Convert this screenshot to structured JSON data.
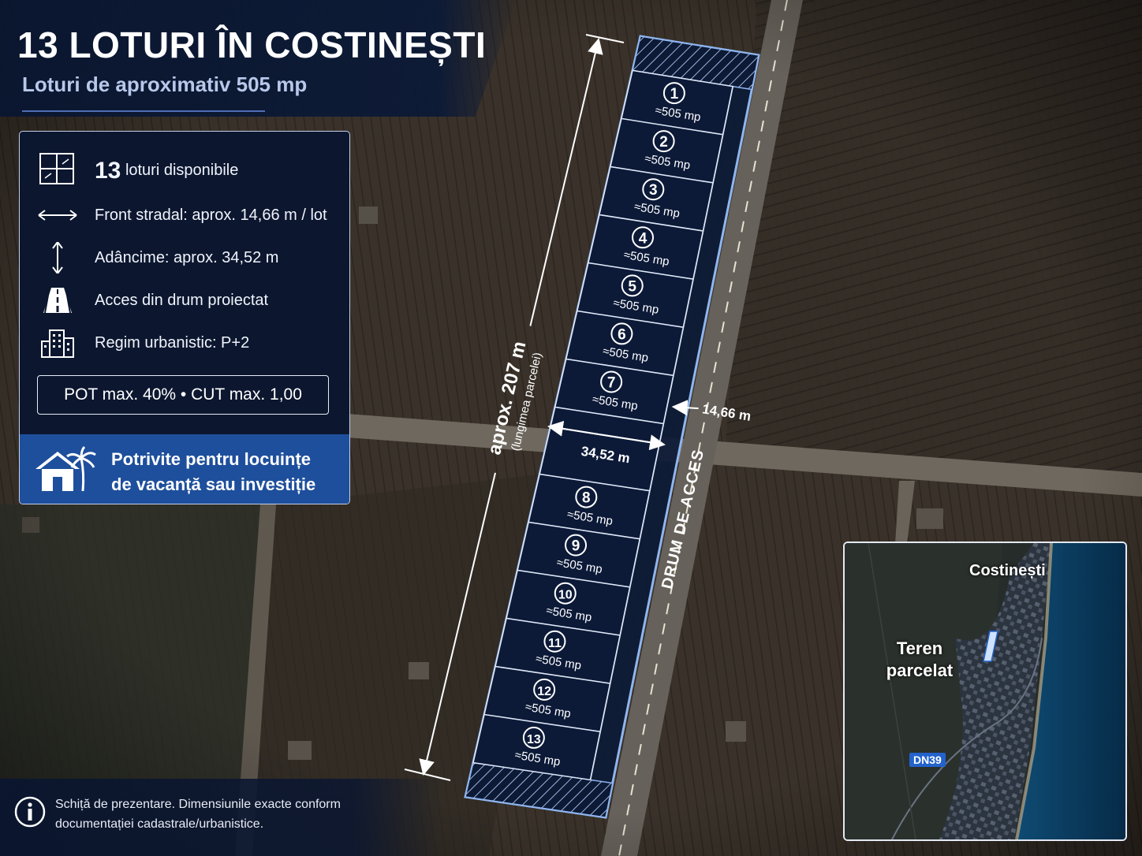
{
  "title": "13 LOTURI ÎN COSTINEȘTI",
  "subtitle": "Loturi de aproximativ 505 mp",
  "info": {
    "lots_count": "13",
    "lots_label": "loturi disponibile",
    "frontage": "Front stradal: aprox. 14,66 m / lot",
    "depth": "Adâncime: aprox. 34,52 m",
    "access": "Acces din drum proiectat",
    "zoning": "Regim urbanistic: P+2",
    "pot_cut": "POT max. 40%  •  CUT max. 1,00",
    "icons": [
      "grid-lots-icon",
      "horizontal-arrow-icon",
      "vertical-arrow-icon",
      "road-icon",
      "building-icon"
    ]
  },
  "promo": {
    "line1": "Potrivite pentru locuințe",
    "line2": "de vacanță sau investiție",
    "icon": "house-palm-icon"
  },
  "lots": [
    {
      "number": "1",
      "area": "≈505 mp"
    },
    {
      "number": "2",
      "area": "≈505 mp"
    },
    {
      "number": "3",
      "area": "≈505 mp"
    },
    {
      "number": "4",
      "area": "≈505 mp"
    },
    {
      "number": "5",
      "area": "≈505 mp"
    },
    {
      "number": "6",
      "area": "≈505 mp"
    },
    {
      "number": "7",
      "area": "≈505 mp"
    },
    {
      "number": "8",
      "area": "≈505 mp"
    },
    {
      "number": "9",
      "area": "≈505 mp"
    },
    {
      "number": "10",
      "area": "≈505 mp"
    },
    {
      "number": "11",
      "area": "≈505 mp"
    },
    {
      "number": "12",
      "area": "≈505 mp"
    },
    {
      "number": "13",
      "area": "≈505 mp"
    }
  ],
  "dimensions": {
    "length": "aprox. 207 m",
    "length_note": "(lungimea parcelei)",
    "width": "34,52 m",
    "frontage": "14,66 m"
  },
  "road_label": "DRUM DE ACCES",
  "disclaimer": {
    "line1": "Schiță de prezentare. Dimensiunile exacte conform",
    "line2": "documentației cadastrale/urbanistice."
  },
  "inset": {
    "city": "Costinești",
    "parcel_label_1": "Teren",
    "parcel_label_2": "parcelat",
    "road_badge": "DN39"
  },
  "colors": {
    "navy": "#0a1630",
    "accent_blue": "#1e4f9c",
    "outline_blue": "#8fb6f0"
  }
}
